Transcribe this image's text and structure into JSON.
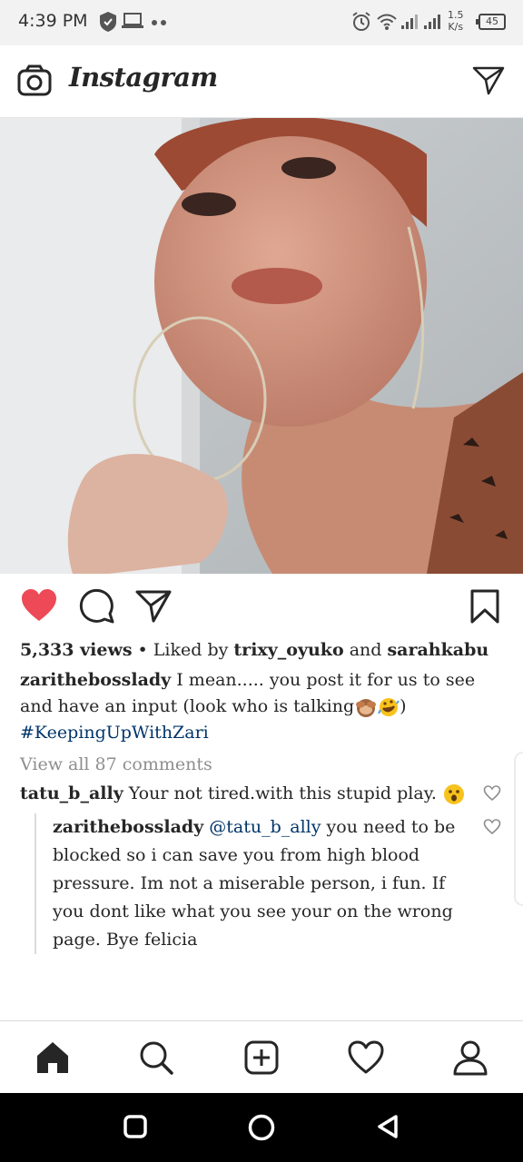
{
  "status_bar": {
    "time": "4:39 PM",
    "net_speed_value": "1.5",
    "net_speed_unit": "K/s",
    "battery": "45"
  },
  "app_bar": {
    "title": "Instagram"
  },
  "post": {
    "views": "5,333 views",
    "liked_prefix": " • Liked by ",
    "liked_user1": "trixy_oyuko",
    "liked_and": " and ",
    "liked_user2": "sarahkabu",
    "caption_user": "zarithebosslady",
    "caption_text": " I mean..... you post it for us to see and have an input (look who is talking",
    "caption_close": ")",
    "hashtag": "#KeepingUpWithZari",
    "view_all": "View all 87 comments"
  },
  "comments": [
    {
      "user": "tatu_b_ally",
      "text": " Your not tired.with this  stupid play. "
    }
  ],
  "reply": {
    "user": "zarithebosslady",
    "mention": "@tatu_b_ally",
    "text": " you need to be blocked so i can save you from high blood pressure. Im not a miserable person, i fun. If you dont like what you see your on the wrong page. Bye felicia"
  },
  "colors": {
    "like_red": "#ed4956",
    "hashtag_blue": "#003569",
    "muted_gray": "#8e8e8e"
  },
  "icons": [
    "camera-icon",
    "direct-message-icon",
    "heart-filled-icon",
    "comment-icon",
    "share-icon",
    "bookmark-icon",
    "home-icon",
    "search-icon",
    "add-post-icon",
    "activity-heart-icon",
    "profile-icon"
  ]
}
